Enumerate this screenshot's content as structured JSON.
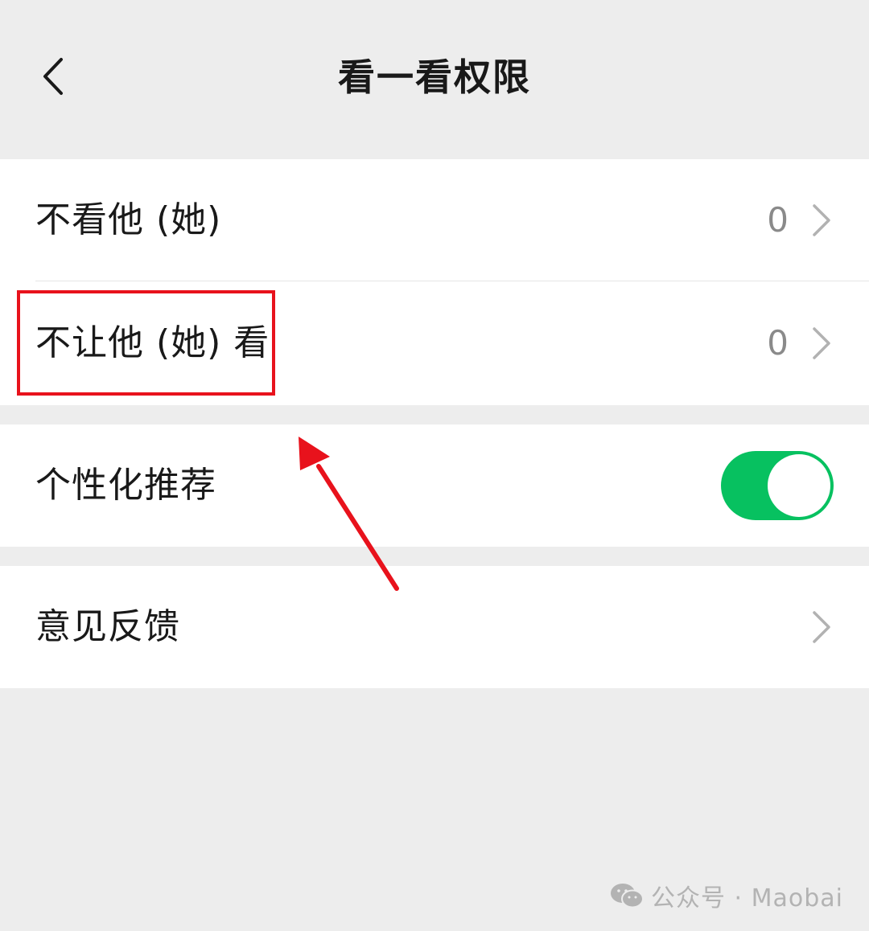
{
  "header": {
    "title": "看一看权限"
  },
  "group1": {
    "items": [
      {
        "label": "不看他 (她)",
        "count": "0"
      },
      {
        "label": "不让他 (她) 看",
        "count": "0"
      }
    ]
  },
  "group2": {
    "label": "个性化推荐",
    "toggle_on": true
  },
  "group3": {
    "label": "意见反馈"
  },
  "annotation": {
    "highlight_color": "#e8121c"
  },
  "watermark": {
    "text": "公众号 · Maobai"
  },
  "colors": {
    "background": "#ededed",
    "toggle_on": "#07c160",
    "count_text": "#8a8a8a"
  }
}
